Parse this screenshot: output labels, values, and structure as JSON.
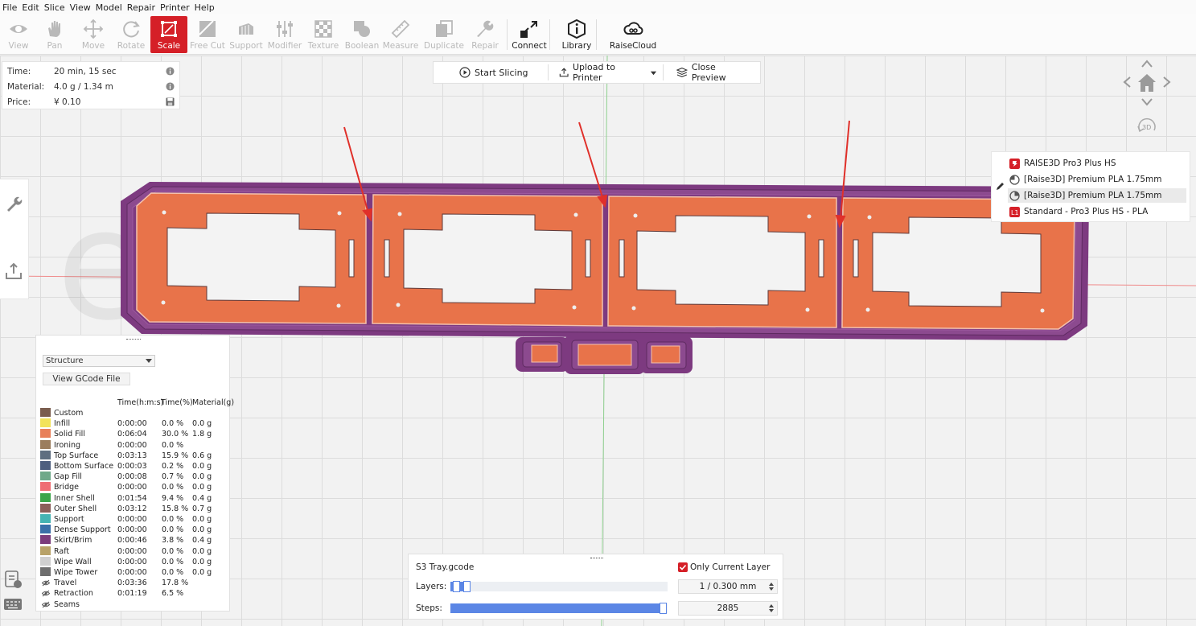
{
  "menu": [
    "File",
    "Edit",
    "Slice",
    "View",
    "Model",
    "Repair",
    "Printer",
    "Help"
  ],
  "toolbar": {
    "tools": [
      {
        "label": "View",
        "icon": "eye-icon"
      },
      {
        "label": "Pan",
        "icon": "hand-icon"
      },
      {
        "label": "Move",
        "icon": "move-icon"
      },
      {
        "label": "Rotate",
        "icon": "rotate-icon"
      },
      {
        "label": "Scale",
        "icon": "scale-icon",
        "active": true
      },
      {
        "label": "Free Cut",
        "icon": "free-cut-icon"
      },
      {
        "label": "Support",
        "icon": "support-icon"
      },
      {
        "label": "Modifier",
        "icon": "modifier-icon"
      },
      {
        "label": "Texture",
        "icon": "texture-icon"
      },
      {
        "label": "Boolean",
        "icon": "boolean-icon"
      },
      {
        "label": "Measure",
        "icon": "measure-icon"
      },
      {
        "label": "Duplicate",
        "icon": "duplicate-icon"
      },
      {
        "label": "Repair",
        "icon": "repair-icon"
      },
      {
        "label": "Connect",
        "icon": "connect-icon"
      },
      {
        "label": "Library",
        "icon": "library-icon"
      },
      {
        "label": "RaiseCloud",
        "icon": "cloud-icon"
      }
    ]
  },
  "info": {
    "time_label": "Time:",
    "time_value": "20 min, 15 sec",
    "material_label": "Material:",
    "material_value": "4.0 g / 1.34 m",
    "price_label": "Price:",
    "price_value": "¥ 0.10"
  },
  "slicing": {
    "start": "Start Slicing",
    "upload": "Upload to Printer",
    "close": "Close Preview"
  },
  "printer": {
    "machine": "RAISE3D Pro3 Plus HS",
    "material_left": "[Raise3D] Premium PLA 1.75mm",
    "material_right": "[Raise3D] Premium PLA 1.75mm",
    "profile": "Standard - Pro3 Plus HS - PLA"
  },
  "structure": {
    "mode": "Structure",
    "gcode_button": "View GCode File",
    "headers": [
      "Time(h:m:s)",
      "Time(%)",
      "Material(g)"
    ],
    "rows": [
      {
        "name": "Custom",
        "color": "#7a5d4e",
        "time": "",
        "pct": "",
        "mat": ""
      },
      {
        "name": "Infill",
        "color": "#f2e35a",
        "time": "0:00:00",
        "pct": "0.0 %",
        "mat": "0.0 g"
      },
      {
        "name": "Solid Fill",
        "color": "#e8805a",
        "time": "0:06:04",
        "pct": "30.0 %",
        "mat": "1.8 g"
      },
      {
        "name": "Ironing",
        "color": "#9b7d5e",
        "time": "0:00:00",
        "pct": "0.0 %",
        "mat": ""
      },
      {
        "name": "Top Surface",
        "color": "#5f6e80",
        "time": "0:03:13",
        "pct": "15.9 %",
        "mat": "0.6 g"
      },
      {
        "name": "Bottom Surface",
        "color": "#4e5f7f",
        "time": "0:00:03",
        "pct": "0.2 %",
        "mat": "0.0 g"
      },
      {
        "name": "Gap Fill",
        "color": "#6fa989",
        "time": "0:00:08",
        "pct": "0.7 %",
        "mat": "0.0 g"
      },
      {
        "name": "Bridge",
        "color": "#ef6d73",
        "time": "0:00:00",
        "pct": "0.0 %",
        "mat": "0.0 g"
      },
      {
        "name": "Inner Shell",
        "color": "#3ba54a",
        "time": "0:01:54",
        "pct": "9.4 %",
        "mat": "0.4 g"
      },
      {
        "name": "Outer Shell",
        "color": "#8b5e5a",
        "time": "0:03:12",
        "pct": "15.8 %",
        "mat": "0.7 g"
      },
      {
        "name": "Support",
        "color": "#45b3b3",
        "time": "0:00:00",
        "pct": "0.0 %",
        "mat": "0.0 g"
      },
      {
        "name": "Dense Support",
        "color": "#3a6fa8",
        "time": "0:00:00",
        "pct": "0.0 %",
        "mat": "0.0 g"
      },
      {
        "name": "Skirt/Brim",
        "color": "#7b3c7c",
        "time": "0:00:46",
        "pct": "3.8 %",
        "mat": "0.4 g"
      },
      {
        "name": "Raft",
        "color": "#b8a268",
        "time": "0:00:00",
        "pct": "0.0 %",
        "mat": "0.0 g"
      },
      {
        "name": "Wipe Wall",
        "color": "#cfcfcf",
        "time": "0:00:00",
        "pct": "0.0 %",
        "mat": "0.0 g"
      },
      {
        "name": "Wipe Tower",
        "color": "#6e6e6e",
        "time": "0:00:00",
        "pct": "0.0 %",
        "mat": "0.0 g"
      },
      {
        "name": "Travel",
        "color": "",
        "eye": true,
        "time": "0:03:36",
        "pct": "17.8 %",
        "mat": ""
      },
      {
        "name": "Retraction",
        "color": "",
        "eye": true,
        "time": "0:01:19",
        "pct": "6.5 %",
        "mat": ""
      },
      {
        "name": "Seams",
        "color": "",
        "eye": true,
        "time": "",
        "pct": "",
        "mat": ""
      }
    ]
  },
  "layers_panel": {
    "filename": "S3 Tray.gcode",
    "only_current_layer": "Only Current Layer",
    "layers_label": "Layers:",
    "layers_value": "1 / 0.300 mm",
    "steps_label": "Steps:",
    "steps_value": "2885",
    "steps_fraction": 1.0
  },
  "colors": {
    "accent": "#d51f27",
    "part_fill": "#e8734a",
    "brim": "#7d3a80",
    "annotation_arrow": "#e0302a",
    "slider": "#5b86e5"
  }
}
